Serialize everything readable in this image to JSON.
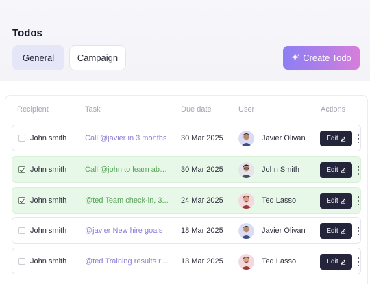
{
  "page": {
    "title": "Todos"
  },
  "tabs": [
    {
      "label": "General",
      "active": true
    },
    {
      "label": "Campaign",
      "active": false
    }
  ],
  "create_button": {
    "label": "Create Todo",
    "icon": "sparkle-icon"
  },
  "table": {
    "columns": [
      "Recipient",
      "Task",
      "Due date",
      "User",
      "Actions"
    ],
    "rows": [
      {
        "recipient": "John smith",
        "task": "Call @javier in 3 months",
        "due": "30 Mar 2025",
        "user": "Javier Olivan",
        "done": false,
        "action": "Edit"
      },
      {
        "recipient": "John smith",
        "task": "Call @john to learn about...",
        "due": "30 Mar 2025",
        "user": "John Smith",
        "done": true,
        "action": "Edit"
      },
      {
        "recipient": "John smith",
        "task": "@ted Team check-in, 3...",
        "due": "24 Mar 2025",
        "user": "Ted Lasso",
        "done": true,
        "action": "Edit"
      },
      {
        "recipient": "John smith",
        "task": "@javier New hire goals",
        "due": "18 Mar 2025",
        "user": "Javier Olivan",
        "done": false,
        "action": "Edit"
      },
      {
        "recipient": "John smith",
        "task": "@ted Training results re...",
        "due": "13 Mar 2025",
        "user": "Ted Lasso",
        "done": false,
        "action": "Edit"
      }
    ]
  },
  "colors": {
    "accent_gradient_start": "#8d7ff3",
    "accent_gradient_end": "#d77edb",
    "done_row_bg": "#e8f8e8",
    "edit_button_bg": "#24253a",
    "task_link": "#8a7fd6"
  }
}
